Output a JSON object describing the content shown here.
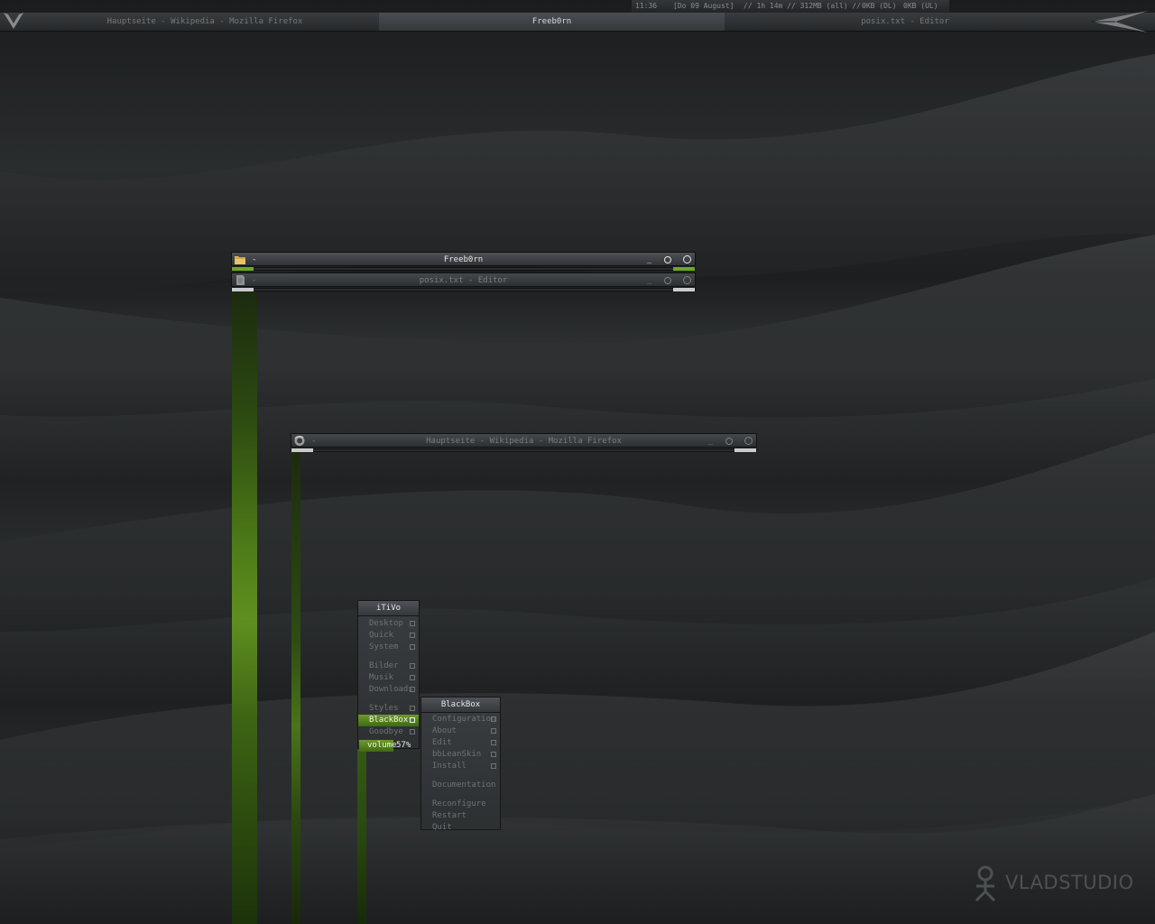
{
  "status_bar": {
    "time": "11:36",
    "date": "[Do 09 August]",
    "uptime": "// 1h 14m // 312MB (all) //",
    "download": "0KB (DL)",
    "upload": "0KB (UL)"
  },
  "taskbar": {
    "tasks": [
      {
        "label": "Hauptseite - Wikipedia - Mozilla Firefox",
        "active": false
      },
      {
        "label": "Freeb0rn",
        "active": true
      },
      {
        "label": "posix.txt - Editor",
        "active": false
      }
    ]
  },
  "windows": {
    "freeborn": {
      "title": "Freeb0rn",
      "dash": "-",
      "minimize": "_"
    },
    "editor": {
      "title": "posix.txt - Editor",
      "dash": "-",
      "minimize": "_"
    },
    "firefox": {
      "title": "Hauptseite - Wikipedia - Mozilla Firefox",
      "dash": "-",
      "minimize": "_"
    }
  },
  "root_menu": {
    "title": "iTiVo",
    "items": [
      "Desktop",
      "Quick",
      "System",
      "Bilder",
      "Musik",
      "Downloads",
      "Styles",
      "BlackBox",
      "Goodbye"
    ],
    "selected": "BlackBox",
    "volume_label": "volume",
    "volume_value": "57%",
    "volume_level": 0.57
  },
  "blackbox_menu": {
    "title": "BlackBox",
    "items": [
      "Configuration",
      "About",
      "Edit",
      "bbLeanSkin",
      "Install",
      "Documentation",
      "Reconfigure",
      "Restart",
      "Quit"
    ]
  },
  "watermark": "VLADSTUDIO",
  "colors": {
    "accent_green": "#6d9a2c",
    "bar_dark": "#26282a",
    "text_muted": "#75787b"
  }
}
